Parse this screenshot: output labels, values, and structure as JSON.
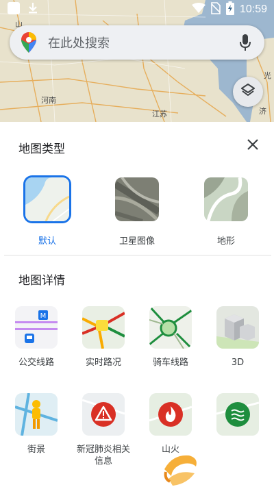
{
  "status_bar": {
    "time": "10:59"
  },
  "map_labels": [
    "山",
    "河南",
    "江苏",
    "光",
    "济"
  ],
  "search": {
    "placeholder": "在此处搜索"
  },
  "sheet": {
    "map_type_title": "地图类型",
    "map_types": [
      {
        "label": "默认",
        "selected": true
      },
      {
        "label": "卫星图像",
        "selected": false
      },
      {
        "label": "地形",
        "selected": false
      }
    ],
    "details_title": "地图详情",
    "details": [
      {
        "label": "公交线路"
      },
      {
        "label": "实时路况"
      },
      {
        "label": "骑车线路"
      },
      {
        "label": "3D"
      },
      {
        "label": "街景"
      },
      {
        "label": "新冠肺炎相关信息"
      },
      {
        "label": "山火"
      },
      {
        "label": ""
      }
    ]
  },
  "colors": {
    "accent": "#1a73e8",
    "map_water": "#9fb8cf",
    "sheet_bg": "#ffffff"
  }
}
